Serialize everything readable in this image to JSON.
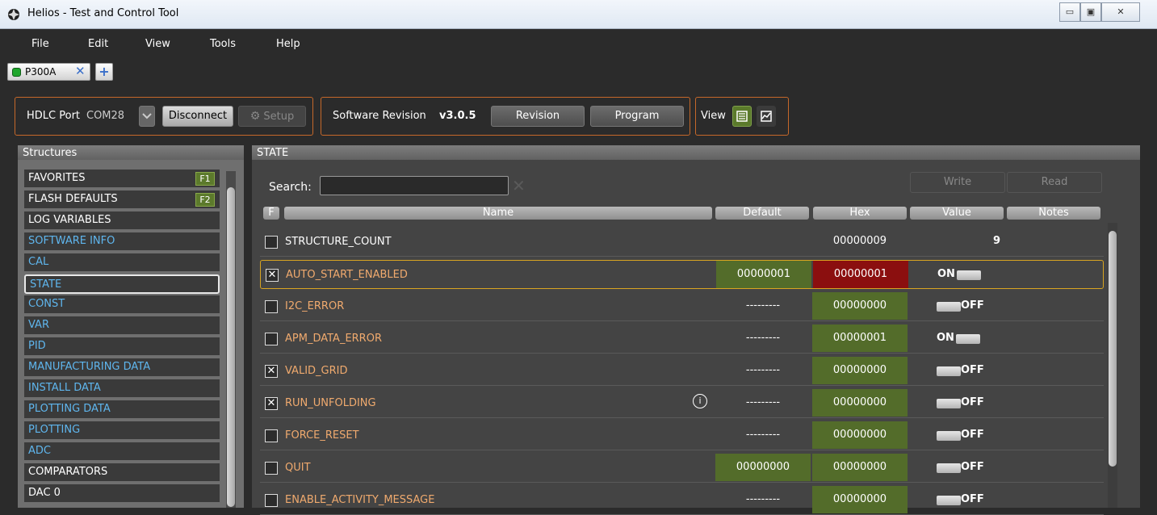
{
  "window": {
    "title": "Helios - Test and Control Tool"
  },
  "menu": [
    "File",
    "Edit",
    "View",
    "Tools",
    "Help"
  ],
  "tabs": [
    {
      "label": "P300A",
      "status_color": "#1fa62c"
    }
  ],
  "toolbar": {
    "hdlc_label": "HDLC Port",
    "hdlc_port": "COM28",
    "disconnect_label": "Disconnect",
    "setup_label": "Setup",
    "sw_rev_label": "Software Revision",
    "sw_rev_value": "v3.0.5",
    "revision_label": "Revision",
    "program_label": "Program",
    "view_label": "View"
  },
  "structures": {
    "header": "Structures",
    "items": [
      {
        "label": "FAVORITES",
        "color": "white",
        "key": "F1"
      },
      {
        "label": "FLASH DEFAULTS",
        "color": "white",
        "key": "F2"
      },
      {
        "label": "LOG VARIABLES",
        "color": "white"
      },
      {
        "label": "SOFTWARE INFO",
        "color": "blue"
      },
      {
        "label": "CAL",
        "color": "blue"
      },
      {
        "label": "STATE",
        "color": "blue",
        "selected": true
      },
      {
        "label": "CONST",
        "color": "blue"
      },
      {
        "label": "VAR",
        "color": "blue"
      },
      {
        "label": "PID",
        "color": "blue"
      },
      {
        "label": "MANUFACTURING DATA",
        "color": "blue"
      },
      {
        "label": "INSTALL DATA",
        "color": "blue"
      },
      {
        "label": "PLOTTING DATA",
        "color": "blue"
      },
      {
        "label": "PLOTTING",
        "color": "blue"
      },
      {
        "label": "ADC",
        "color": "blue"
      },
      {
        "label": "COMPARATORS",
        "color": "white"
      },
      {
        "label": "DAC 0",
        "color": "white"
      }
    ]
  },
  "state": {
    "header": "STATE",
    "search_label": "Search:",
    "search_value": "",
    "write_label": "Write",
    "read_label": "Read",
    "columns": {
      "f": "F",
      "name": "Name",
      "default": "Default",
      "hex": "Hex",
      "value": "Value",
      "notes": "Notes"
    },
    "rows": [
      {
        "checked": false,
        "name": "STRUCTURE_COUNT",
        "name_color": "white",
        "default": "",
        "hex": "00000009",
        "hex_style": "plain",
        "value": "9",
        "value_type": "number"
      },
      {
        "checked": true,
        "name": "AUTO_START_ENABLED",
        "name_color": "orange",
        "default": "00000001",
        "default_style": "green",
        "hex": "00000001",
        "hex_style": "red",
        "value": "ON",
        "value_type": "toggle-on",
        "selected": true
      },
      {
        "checked": false,
        "name": "I2C_ERROR",
        "name_color": "orange",
        "default": "---------",
        "hex": "00000000",
        "hex_style": "green",
        "value": "OFF",
        "value_type": "toggle-off"
      },
      {
        "checked": false,
        "name": "APM_DATA_ERROR",
        "name_color": "orange",
        "default": "---------",
        "hex": "00000001",
        "hex_style": "green",
        "value": "ON",
        "value_type": "toggle-on"
      },
      {
        "checked": true,
        "name": "VALID_GRID",
        "name_color": "orange",
        "default": "---------",
        "hex": "00000000",
        "hex_style": "green",
        "value": "OFF",
        "value_type": "toggle-off"
      },
      {
        "checked": true,
        "name": "RUN_UNFOLDING",
        "name_color": "orange",
        "default": "---------",
        "hex": "00000000",
        "hex_style": "green",
        "value": "OFF",
        "value_type": "toggle-off",
        "info": true
      },
      {
        "checked": false,
        "name": "FORCE_RESET",
        "name_color": "orange",
        "default": "---------",
        "hex": "00000000",
        "hex_style": "green",
        "value": "OFF",
        "value_type": "toggle-off"
      },
      {
        "checked": false,
        "name": "QUIT",
        "name_color": "orange",
        "default": "00000000",
        "default_style": "green",
        "hex": "00000000",
        "hex_style": "green",
        "value": "OFF",
        "value_type": "toggle-off"
      },
      {
        "checked": false,
        "name": "ENABLE_ACTIVITY_MESSAGE",
        "name_color": "orange",
        "default": "---------",
        "hex": "00000000",
        "hex_style": "green",
        "value": "OFF",
        "value_type": "toggle-off"
      }
    ]
  },
  "icons": {
    "app": "helios-logo-icon",
    "setup": "gear-icon",
    "view_table": "table-view-icon",
    "view_chart": "chart-view-icon",
    "info": "info-icon",
    "clear": "clear-search-icon"
  }
}
